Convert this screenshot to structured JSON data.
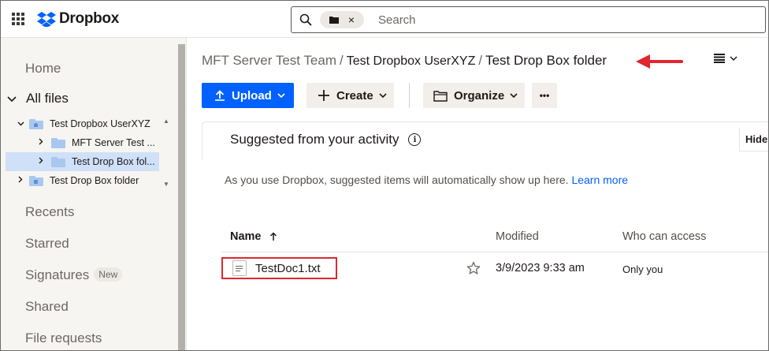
{
  "app": {
    "logo_text": "Dropbox",
    "accent_color": "#0061fe",
    "annotation_color": "#e0262f"
  },
  "search": {
    "placeholder": "Search",
    "chip_icon": "folder-icon",
    "chip_close": "×"
  },
  "sidebar": {
    "home": "Home",
    "all_files": "All files",
    "tree": [
      {
        "label": "Test Dropbox UserXYZ",
        "icon": "team-member-folder-icon",
        "expanded": true
      },
      {
        "label": "MFT Server Test ...",
        "icon": "folder-icon",
        "expanded": false
      },
      {
        "label": "Test Drop Box fol...",
        "icon": "folder-icon",
        "expanded": false,
        "selected": true
      },
      {
        "label": "Test Drop Box folder",
        "icon": "shared-folder-icon",
        "expanded": false
      }
    ],
    "recents": "Recents",
    "starred": "Starred",
    "signatures": "Signatures",
    "signatures_badge": "New",
    "shared": "Shared",
    "file_requests": "File requests"
  },
  "breadcrumb": {
    "team": "MFT Server Test Team",
    "sep": "/",
    "user": "Test Dropbox UserXYZ",
    "current": "Test Drop Box folder"
  },
  "toolbar": {
    "upload": "Upload",
    "create": "Create",
    "organize": "Organize",
    "more": "•••"
  },
  "suggested": {
    "title": "Suggested from your activity",
    "hide": "Hide",
    "text": "As you use Dropbox, suggested items will automatically show up here.",
    "learn_more": "Learn more"
  },
  "table": {
    "columns": {
      "name": "Name",
      "modified": "Modified",
      "who": "Who can access"
    },
    "rows": [
      {
        "name": "TestDoc1.txt",
        "modified": "3/9/2023 9:33 am",
        "who": "Only you"
      }
    ]
  }
}
